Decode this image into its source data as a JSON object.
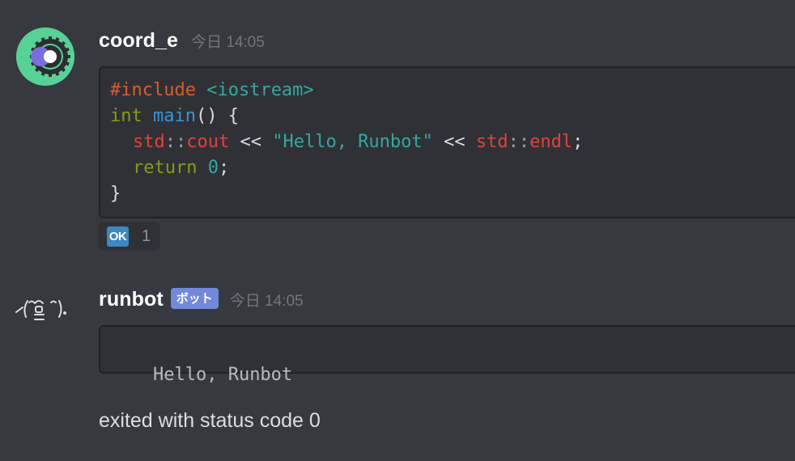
{
  "messages": [
    {
      "author": "coord_e",
      "timestamp": "今日 14:05",
      "code_lines": [
        [
          {
            "t": "#include",
            "c": "pre"
          },
          {
            "t": " ",
            "c": "plain"
          },
          {
            "t": "<iostream>",
            "c": "lib"
          }
        ],
        [
          {
            "t": "int",
            "c": "type"
          },
          {
            "t": " ",
            "c": "plain"
          },
          {
            "t": "main",
            "c": "fn"
          },
          {
            "t": "() {",
            "c": "plain"
          }
        ],
        [
          {
            "t": "std",
            "c": "ns"
          },
          {
            "t": "::",
            "c": "op"
          },
          {
            "t": "cout",
            "c": "ns"
          },
          {
            "t": " << ",
            "c": "plain"
          },
          {
            "t": "\"Hello, Runbot\"",
            "c": "str"
          },
          {
            "t": " << ",
            "c": "plain"
          },
          {
            "t": "std",
            "c": "ns"
          },
          {
            "t": "::",
            "c": "op"
          },
          {
            "t": "endl",
            "c": "ns"
          },
          {
            "t": ";",
            "c": "plain"
          }
        ],
        [
          {
            "t": "return",
            "c": "kw"
          },
          {
            "t": " ",
            "c": "plain"
          },
          {
            "t": "0",
            "c": "num"
          },
          {
            "t": ";",
            "c": "plain"
          }
        ],
        [
          {
            "t": "}",
            "c": "plain"
          }
        ]
      ],
      "code_indent": [
        0,
        0,
        1,
        1,
        0
      ],
      "reaction": {
        "emoji": "OK",
        "count": "1"
      }
    },
    {
      "author": "runbot",
      "bot_tag": "ボット",
      "timestamp": "今日 14:05",
      "avatar_text": "ヽ(ºロº)ﾉ",
      "code_output": "Hello, Runbot",
      "status": "exited with status code 0"
    }
  ],
  "colors": {
    "background": "#36393f",
    "codeblock": "#2f3136",
    "bot_tag": "#7289da",
    "avatar": "#58d197",
    "ok_emoji": "#3b88c3"
  },
  "icons": {
    "user_avatar": "gear-ring-avatar-icon",
    "bot_avatar": "kaomoji-face-icon",
    "reaction": "ok-button-emoji"
  }
}
